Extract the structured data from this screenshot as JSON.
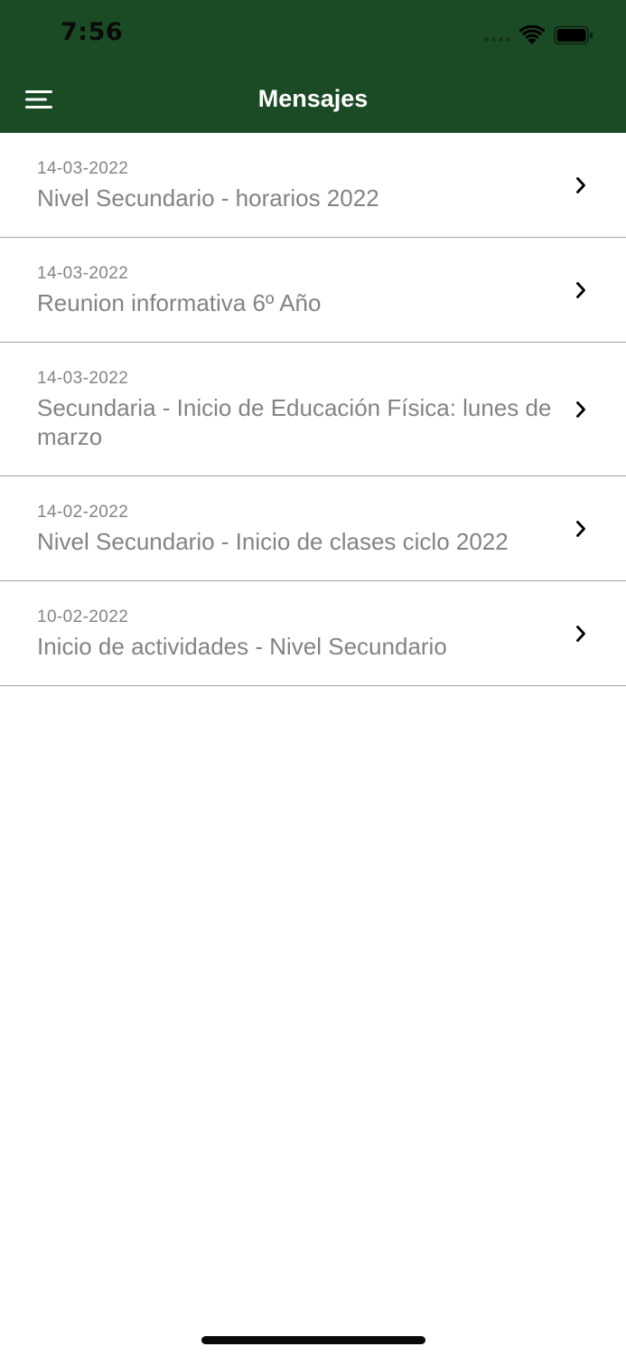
{
  "status_bar": {
    "time": "7:56"
  },
  "nav": {
    "title": "Mensajes",
    "menu_icon": "hamburger-icon"
  },
  "messages": [
    {
      "date": "14-03-2022",
      "title": "Nivel Secundario - horarios 2022"
    },
    {
      "date": "14-03-2022",
      "title": "Reunion informativa 6º Año"
    },
    {
      "date": "14-03-2022",
      "title": "Secundaria - Inicio de Educación Física: lunes de marzo"
    },
    {
      "date": "14-02-2022",
      "title": "Nivel Secundario - Inicio de clases ciclo 2022"
    },
    {
      "date": "10-02-2022",
      "title": "Inicio de actividades - Nivel Secundario"
    }
  ],
  "colors": {
    "header_bg": "#1b4b24",
    "text_muted": "#838383",
    "separator": "#a5a5a5"
  }
}
